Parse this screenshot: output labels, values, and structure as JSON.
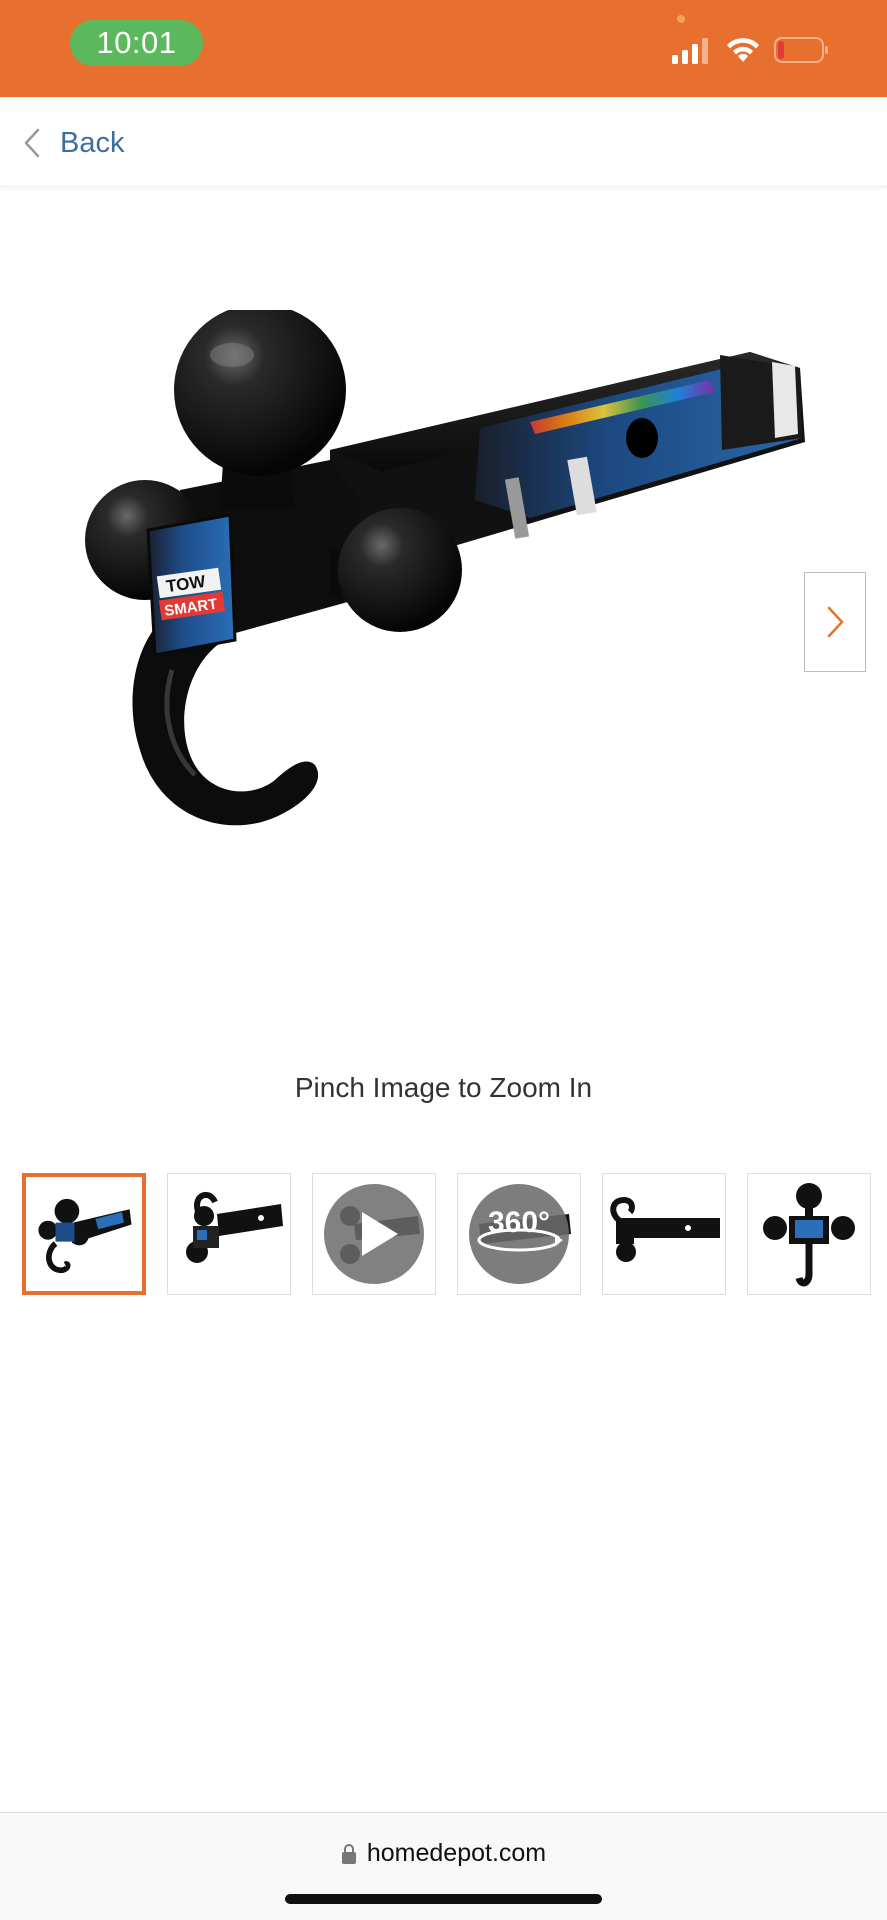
{
  "status_bar": {
    "time": "10:01",
    "background_color": "#E8702E",
    "time_pill_color": "#5CB85C",
    "icons": [
      "signal-icon",
      "wifi-icon",
      "battery-low-icon"
    ]
  },
  "nav": {
    "back_label": "Back",
    "back_icon": "chevron-left-icon"
  },
  "product": {
    "image_label": "TOW SMART",
    "image_label_top": "TOW",
    "image_label_bottom": "SMART",
    "next_icon": "chevron-right-icon"
  },
  "zoom_hint": "Pinch Image to Zoom In",
  "thumbnails": [
    {
      "kind": "image",
      "selected": true
    },
    {
      "kind": "image",
      "selected": false
    },
    {
      "kind": "video",
      "icon": "play-icon",
      "selected": false
    },
    {
      "kind": "spin",
      "label": "360°",
      "selected": false
    },
    {
      "kind": "image",
      "selected": false
    },
    {
      "kind": "image",
      "selected": false
    }
  ],
  "thumb_360_label": "360°",
  "browser": {
    "url": "homedepot.com",
    "lock_icon": "lock-icon"
  },
  "colors": {
    "accent": "#E8702E",
    "link": "#3E6EA0"
  }
}
